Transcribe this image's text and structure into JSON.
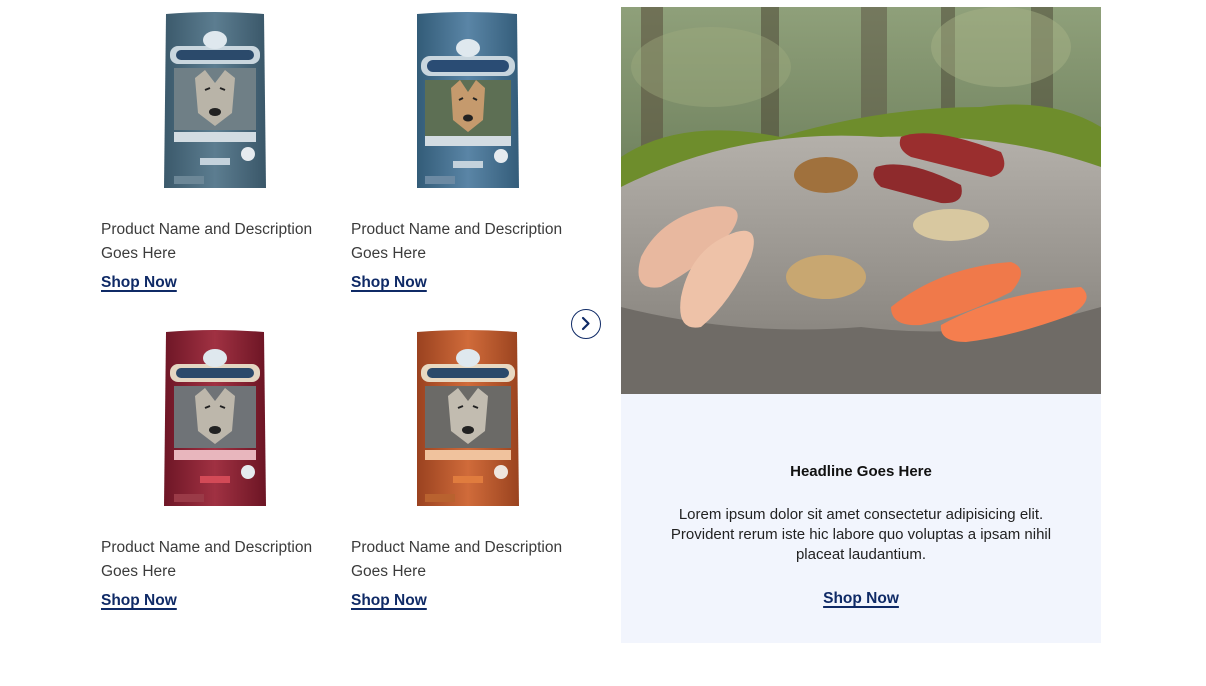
{
  "products": [
    {
      "name": "Product Name and Description Goes Here",
      "shop_label": "Shop Now",
      "bag_color": "#4a6a7e",
      "bag_variant": "Adult"
    },
    {
      "name": "Product Name and Description Goes Here",
      "shop_label": "Shop Now",
      "bag_color": "#3f6582",
      "bag_variant": "Puppy"
    },
    {
      "name": "Product Name and Description Goes Here",
      "shop_label": "Shop Now",
      "bag_color": "#8a2233",
      "bag_variant": "Adult"
    },
    {
      "name": "Product Name and Description Goes Here",
      "shop_label": "Shop Now",
      "bag_color": "#b8562a",
      "bag_variant": "Senior"
    }
  ],
  "carousel": {
    "next_icon": "chevron-right-icon"
  },
  "promo": {
    "headline": "Headline Goes Here",
    "body": "Lorem ipsum dolor sit amet consectetur adipisicing elit. Provident rerum iste hic labore quo voluptas a ipsam nihil placeat laudantium.",
    "shop_label": "Shop Now",
    "background": "#f2f5fd"
  },
  "colors": {
    "link": "#0f2a66",
    "text": "#3b3b3b"
  }
}
